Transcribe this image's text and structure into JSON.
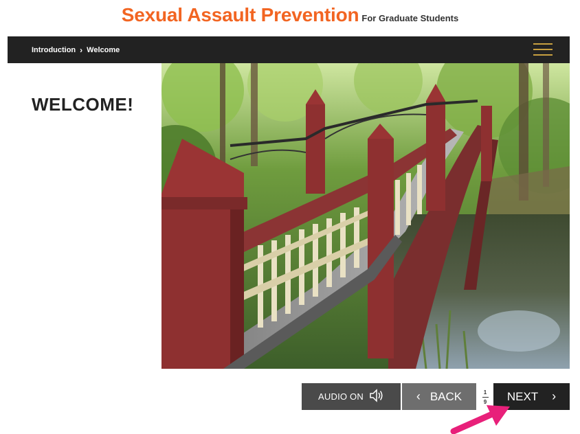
{
  "header": {
    "title": "Sexual Assault Prevention",
    "subtitle": "For Graduate Students"
  },
  "navbar": {
    "breadcrumb": {
      "section": "Introduction",
      "separator": "›",
      "page": "Welcome"
    },
    "menu_icon": "hamburger-menu-icon"
  },
  "main": {
    "title": "WELCOME!",
    "image": "footbridge-photo"
  },
  "controls": {
    "audio_label": "AUDIO ON",
    "audio_icon": "speaker-icon",
    "back_label": "BACK",
    "next_label": "NEXT",
    "page_current": "1",
    "page_total": "9"
  },
  "colors": {
    "brand_orange": "#f26522",
    "navbar_bg": "#222222",
    "menu_gold": "#c8a040",
    "arrow_pink": "#e8207a"
  }
}
